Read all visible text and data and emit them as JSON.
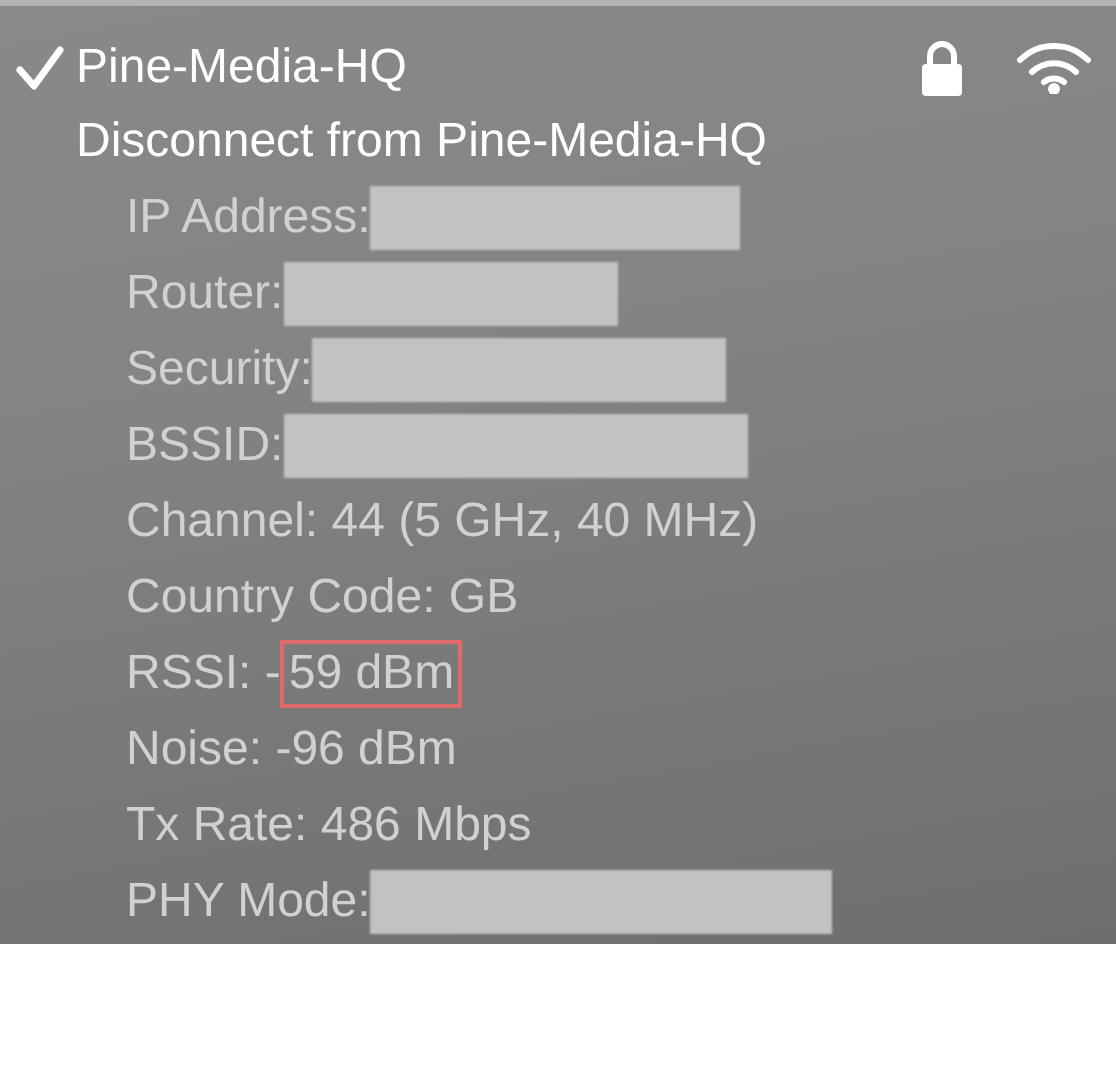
{
  "network": {
    "name": "Pine-Media-HQ",
    "checked": true,
    "locked": true
  },
  "disconnect": "Disconnect from Pine-Media-HQ",
  "details": [
    {
      "kind": "redacted",
      "label": "IP Address:"
    },
    {
      "kind": "redacted",
      "label": "Router:"
    },
    {
      "kind": "redacted",
      "label": "Security:"
    },
    {
      "kind": "redacted",
      "label": "BSSID:"
    },
    {
      "kind": "text",
      "label": "Channel: 44 (5 GHz, 40 MHz)"
    },
    {
      "kind": "text",
      "label": "Country Code: GB"
    },
    {
      "kind": "highlight",
      "label": "RSSI: -",
      "value": "59 dBm"
    },
    {
      "kind": "text",
      "label": "Noise: -96 dBm"
    },
    {
      "kind": "text",
      "label": "Tx Rate: 486 Mbps"
    },
    {
      "kind": "redacted",
      "label": "PHY Mode:"
    }
  ]
}
